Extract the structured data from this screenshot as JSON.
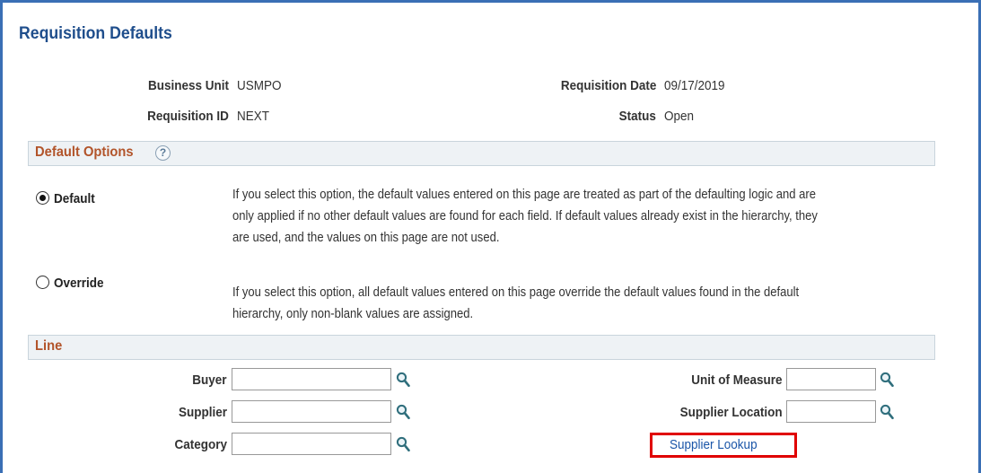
{
  "page": {
    "title": "Requisition Defaults"
  },
  "header": {
    "business_unit_label": "Business Unit",
    "business_unit_value": "USMPO",
    "requisition_id_label": "Requisition ID",
    "requisition_id_value": "NEXT",
    "requisition_date_label": "Requisition Date",
    "requisition_date_value": "09/17/2019",
    "status_label": "Status",
    "status_value": "Open"
  },
  "default_options": {
    "title": "Default Options",
    "help_glyph": "?",
    "selected": "Default",
    "options": [
      {
        "label": "Default",
        "checked": true,
        "description": [
          "If you select this option, the default values entered on this page are treated as part of the defaulting logic and are",
          "only applied if no other default values are found for each field. If default values already exist in the hierarchy, they",
          "are used, and the values on this page are not used."
        ]
      },
      {
        "label": "Override",
        "checked": false,
        "description": [
          "If you select this option, all default values entered on this page override the default values found in the default",
          "hierarchy, only non-blank values are assigned."
        ]
      }
    ]
  },
  "line": {
    "title": "Line",
    "buyer_label": "Buyer",
    "buyer_value": "",
    "supplier_label": "Supplier",
    "supplier_value": "",
    "category_label": "Category",
    "category_value": "",
    "uom_label": "Unit of Measure",
    "uom_value": "",
    "supplier_location_label": "Supplier Location",
    "supplier_location_value": "",
    "supplier_lookup_link": "Supplier Lookup"
  },
  "icons": {
    "lookup": "magnifier-icon",
    "help": "help-icon"
  },
  "colors": {
    "title": "#1f4e8c",
    "section_title": "#b2542a",
    "frame": "#3a6fb5",
    "highlight": "#e00000",
    "link": "#1a55a8"
  }
}
